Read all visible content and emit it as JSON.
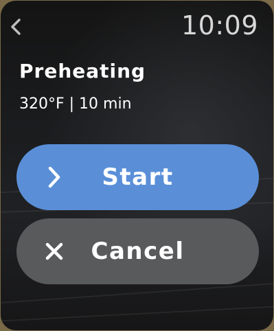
{
  "status_bar": {
    "back_icon": "chevron-left-icon",
    "time": "10:09"
  },
  "main": {
    "title": "Preheating",
    "subtitle": "320°F | 10 min"
  },
  "actions": {
    "start": {
      "label": "Start",
      "icon": "chevron-right-icon",
      "color": "#5a8fd8"
    },
    "cancel": {
      "label": "Cancel",
      "icon": "close-icon",
      "color": "#595a5c"
    }
  }
}
